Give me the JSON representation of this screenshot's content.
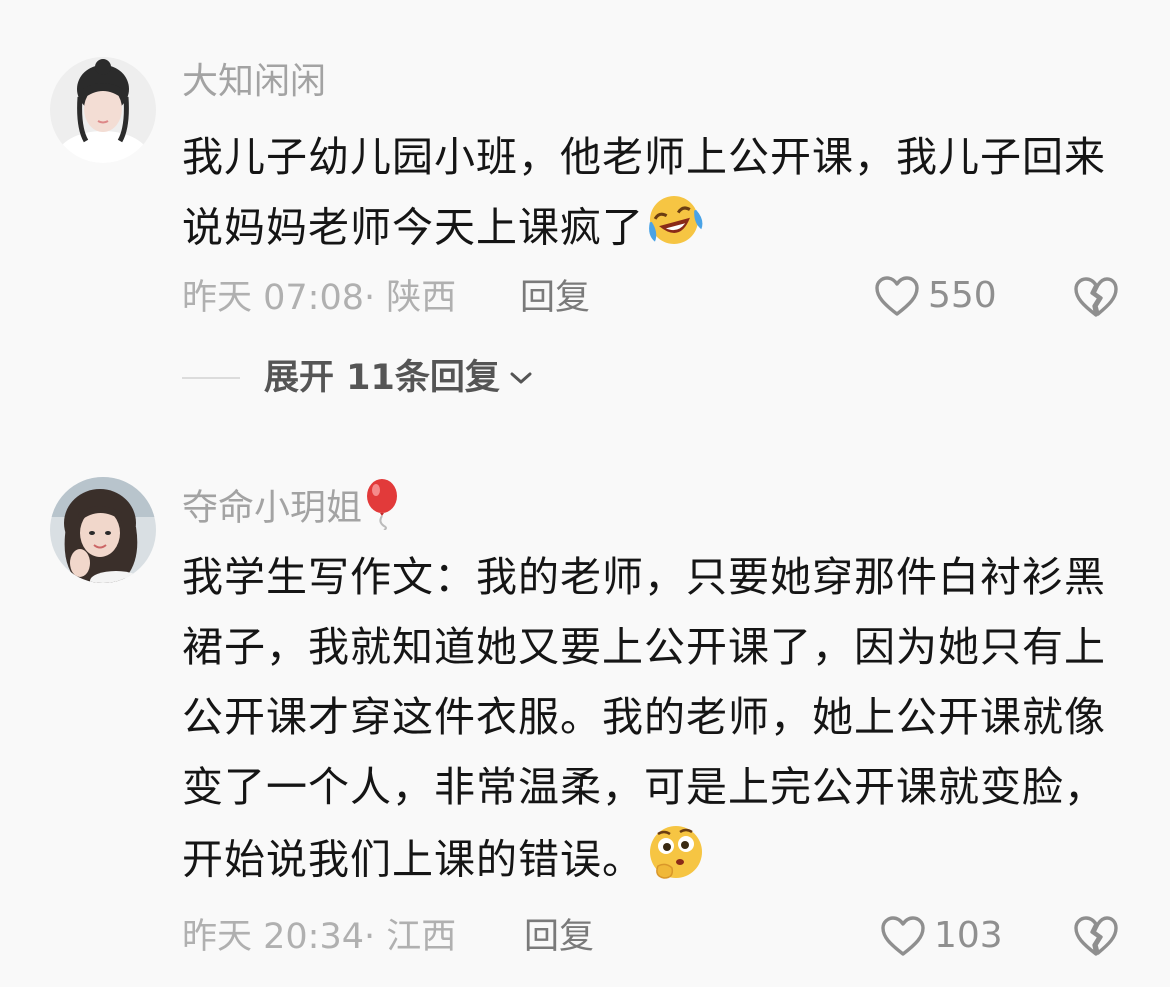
{
  "comments": [
    {
      "username": "大知闲闲",
      "text": "我儿子幼儿园小班，他老师上公开课，我儿子回来说妈妈老师今天上课疯了",
      "emoji": "laugh-cry-emoji",
      "time": "昨天 07:08",
      "location": "· 陕西",
      "reply_label": "回复",
      "likes": "550",
      "expand_label": "展开 11条回复"
    },
    {
      "username": "夺命小玥姐",
      "username_emoji": "balloon-emoji",
      "text": "我学生写作文：我的老师，只要她穿那件白衬衫黑裙子，我就知道她又要上公开课了，因为她只有上公开课才穿这件衣服。我的老师，她上公开课就像变了一个人，非常温柔，可是上完公开课就变脸，开始说我们上课的错误。",
      "emoji": "thinking-emoji",
      "time": "昨天 20:34",
      "location": "· 江西",
      "reply_label": "回复",
      "likes": "103"
    }
  ]
}
